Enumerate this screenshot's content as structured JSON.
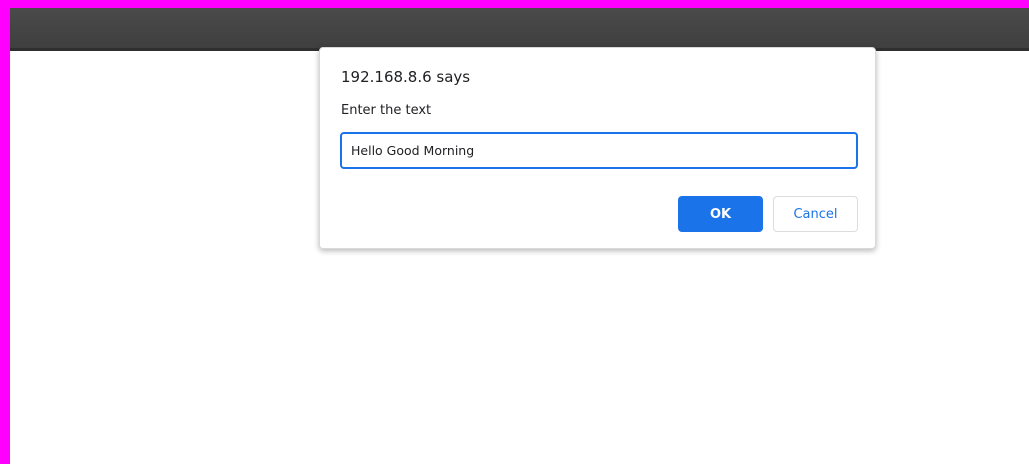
{
  "colors": {
    "frame_border": "#ff00ff",
    "topbar": "#434343",
    "accent": "#1a73e8"
  },
  "dialog": {
    "title": "192.168.8.6 says",
    "message": "Enter the text",
    "input_value": "Hello Good Morning",
    "ok_label": "OK",
    "cancel_label": "Cancel"
  }
}
